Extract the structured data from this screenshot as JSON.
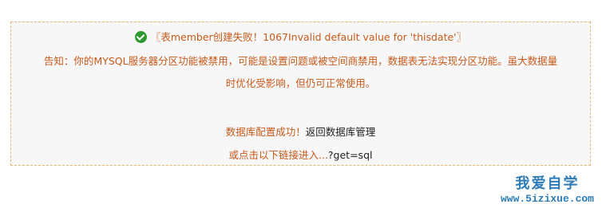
{
  "notice": {
    "error_message": "〖表member创建失败！1067Invalid default value for 'thisdate'〗",
    "warning_line1": "告知：你的MYSQL服务器分区功能被禁用，可能是设置问题或被空间商禁用，数据表无法实现分区功能。虽大数据量",
    "warning_line2": "时优化受影响，但仍可正常使用。",
    "success_text": "数据库配置成功！",
    "back_link": "返回数据库管理",
    "enter_prefix": "或点击以下链接进入...",
    "enter_link": "?get=sql"
  },
  "watermark": {
    "title": "我爱自学",
    "url": "www.5izixue.com"
  },
  "colors": {
    "warning_text": "#c75a1a",
    "success_icon": "#2d9a2f",
    "box_border": "#e2b970",
    "watermark": "#2d7cb8"
  }
}
